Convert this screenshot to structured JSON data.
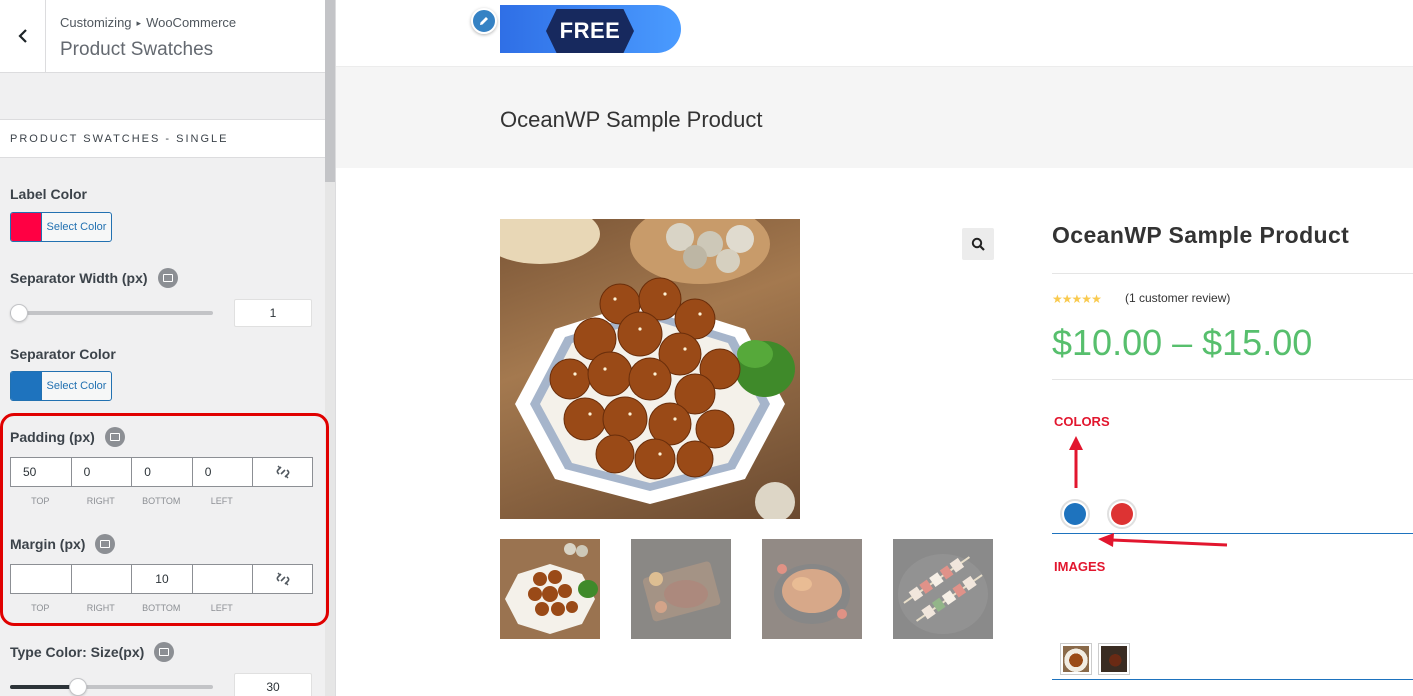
{
  "customizer": {
    "breadcrumb": {
      "root": "Customizing",
      "separator": "▸",
      "parent": "WooCommerce"
    },
    "panel_title": "Product Swatches",
    "section_title": "PRODUCT SWATCHES - SINGLE",
    "label_color": {
      "label": "Label Color",
      "button": "Select Color",
      "value": "#ff0043"
    },
    "separator_width": {
      "label": "Separator Width (px)",
      "value": "1",
      "slider_fraction": 0.02
    },
    "separator_color": {
      "label": "Separator Color",
      "button": "Select Color",
      "value": "#1e73be"
    },
    "padding": {
      "label": "Padding (px)",
      "top": "50",
      "right": "0",
      "bottom": "0",
      "left": "0"
    },
    "margin": {
      "label": "Margin (px)",
      "top": "",
      "right": "",
      "bottom": "10",
      "left": ""
    },
    "side_labels": {
      "top": "TOP",
      "right": "RIGHT",
      "bottom": "BOTTOM",
      "left": "LEFT"
    },
    "type_color_size": {
      "label": "Type Color: Size(px)",
      "value": "30",
      "slider_fraction": 0.31
    }
  },
  "preview": {
    "banner_text": "FREE",
    "page_title": "OceanWP Sample Product",
    "product_title": "OceanWP Sample Product",
    "rating_stars": 5,
    "review_link": "(1 customer review)",
    "price": "$10.00 – $15.00",
    "annotation_colors": "COLORS",
    "annotation_images": "IMAGES",
    "swatch_colors": [
      "#1e73be",
      "#dd3333"
    ]
  },
  "theme": {
    "accent": "#2271b1",
    "price_color": "#57bf6d",
    "annotation_color": "#e2162e"
  }
}
